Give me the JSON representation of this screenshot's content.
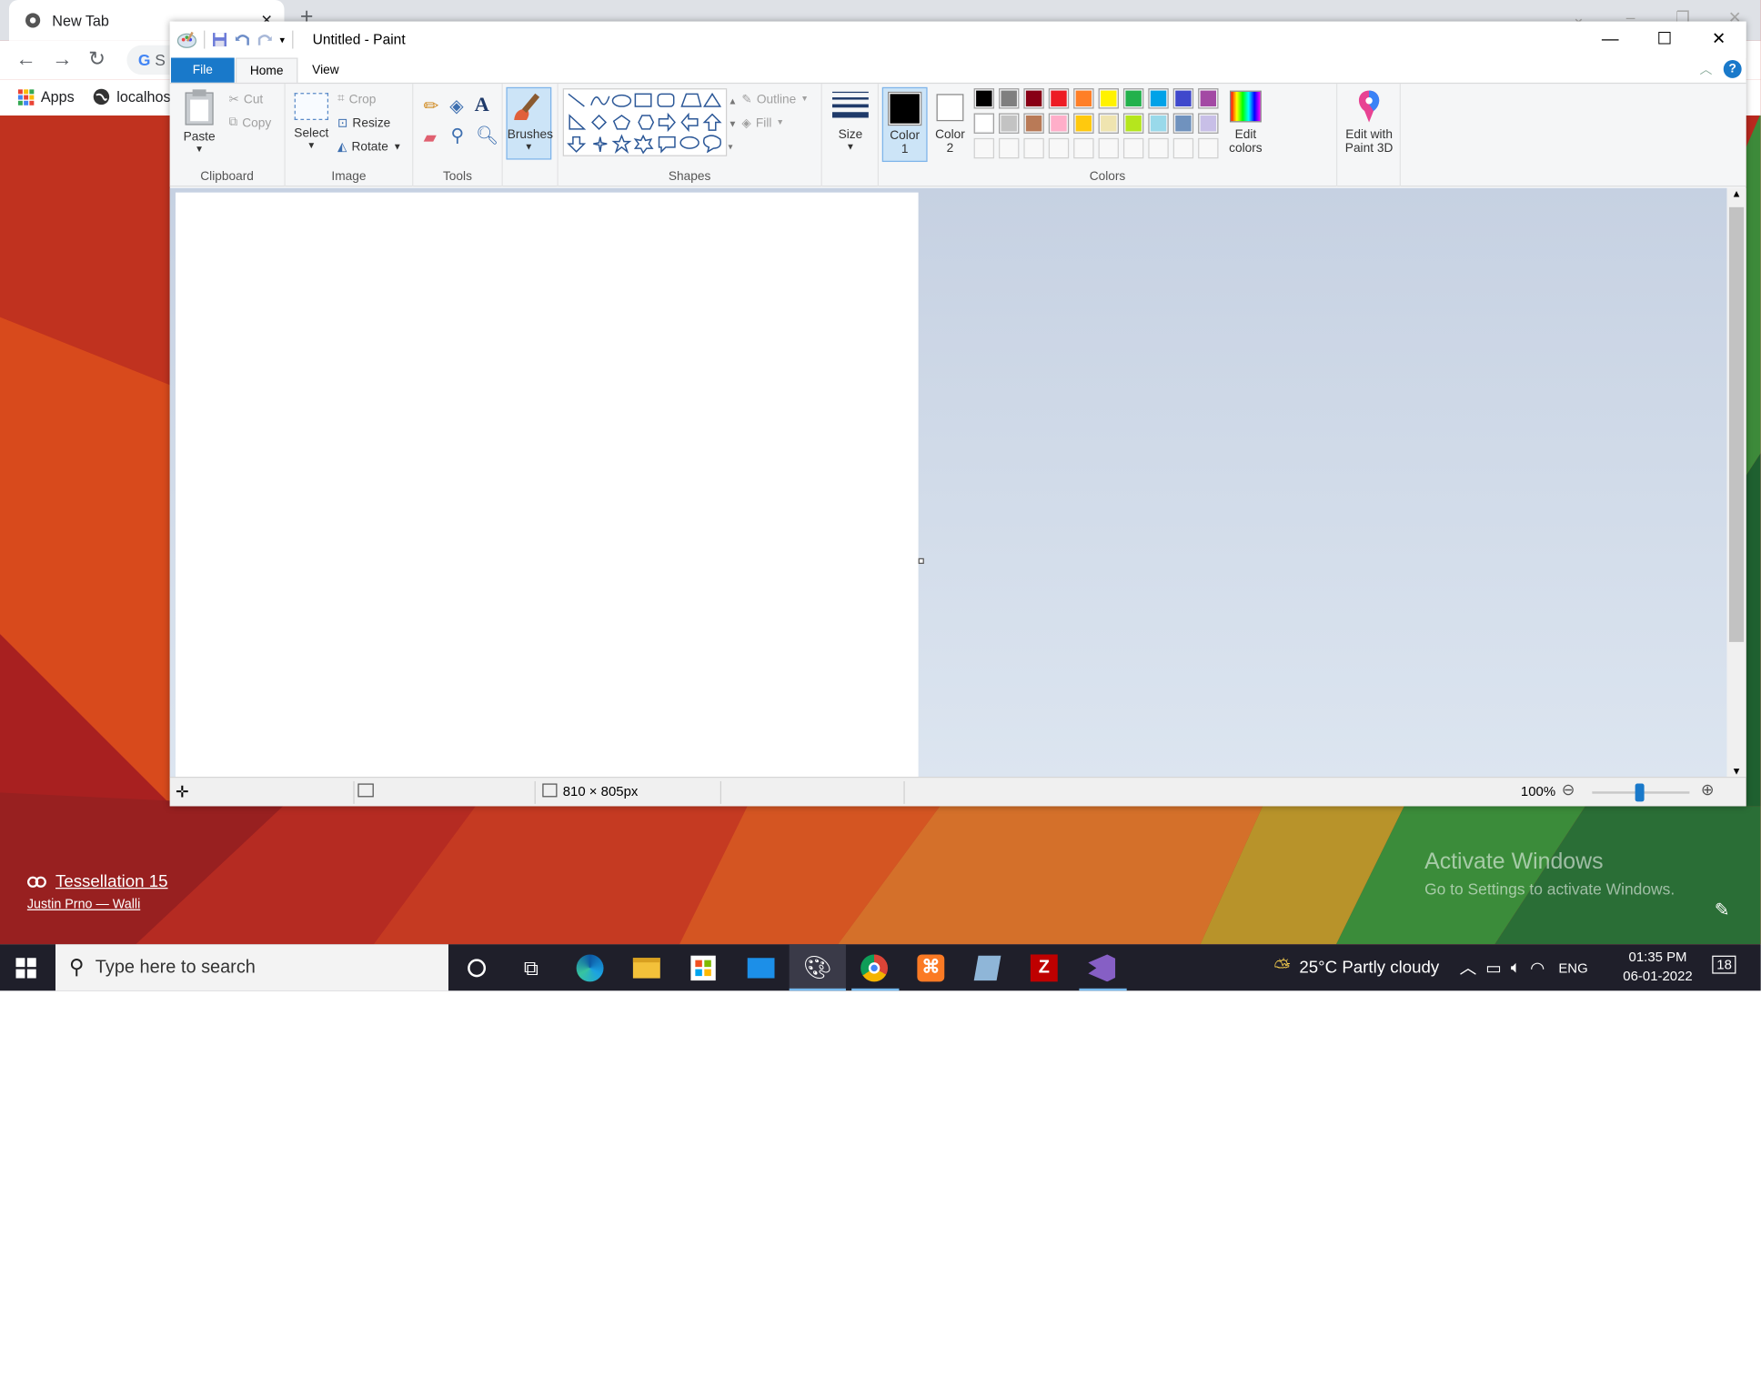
{
  "browser": {
    "tab_title": "New Tab",
    "omnibox_text": "S",
    "bookmarks": [
      {
        "label": "Apps"
      },
      {
        "label": "localhos"
      }
    ]
  },
  "paint": {
    "window_title": "Untitled - Paint",
    "ribbon_tabs": [
      {
        "label": "File"
      },
      {
        "label": "Home"
      },
      {
        "label": "View"
      }
    ],
    "clipboard": {
      "paste": "Paste",
      "cut": "Cut",
      "copy": "Copy",
      "group": "Clipboard"
    },
    "image": {
      "select": "Select",
      "crop": "Crop",
      "resize": "Resize",
      "rotate": "Rotate",
      "group": "Image"
    },
    "tools": {
      "group": "Tools"
    },
    "brushes": {
      "label": "Brushes"
    },
    "shapes": {
      "outline": "Outline",
      "fill": "Fill",
      "group": "Shapes"
    },
    "size": {
      "label": "Size"
    },
    "colors": {
      "color1_l1": "Color",
      "color1_l2": "1",
      "color2_l1": "Color",
      "color2_l2": "2",
      "edit_l1": "Edit",
      "edit_l2": "colors",
      "group": "Colors",
      "color1_value": "#000000",
      "color2_value": "#ffffff",
      "palette_row1": [
        "#000000",
        "#7f7f7f",
        "#880015",
        "#ed1c24",
        "#ff7f27",
        "#fff200",
        "#22b14c",
        "#00a2e8",
        "#3f48cc",
        "#a349a4"
      ],
      "palette_row2": [
        "#ffffff",
        "#c3c3c3",
        "#b97a57",
        "#ffaec9",
        "#ffc90e",
        "#efe4b0",
        "#b5e61d",
        "#99d9ea",
        "#7092be",
        "#c8bfe7"
      ]
    },
    "paint3d": {
      "l1": "Edit with",
      "l2": "Paint 3D"
    },
    "status": {
      "dimensions": "810 × 805px",
      "zoom": "100%"
    }
  },
  "wallpaper": {
    "title": "Tessellation 15",
    "credit": "Justin Prno — Walli"
  },
  "activation": {
    "line1": "Activate Windows",
    "line2": "Go to Settings to activate Windows."
  },
  "taskbar": {
    "search_placeholder": "Type here to search",
    "weather": "25°C  Partly cloudy",
    "language": "ENG",
    "time": "01:35 PM",
    "date": "06-01-2022",
    "notifications": "18",
    "apps": [
      {
        "name": "edge-icon"
      },
      {
        "name": "file-explorer-icon"
      },
      {
        "name": "store-icon"
      },
      {
        "name": "mail-icon"
      },
      {
        "name": "paint-icon"
      },
      {
        "name": "chrome-icon"
      },
      {
        "name": "xampp-icon"
      },
      {
        "name": "notepad-icon"
      },
      {
        "name": "filezilla-icon"
      },
      {
        "name": "visual-studio-icon"
      }
    ]
  }
}
